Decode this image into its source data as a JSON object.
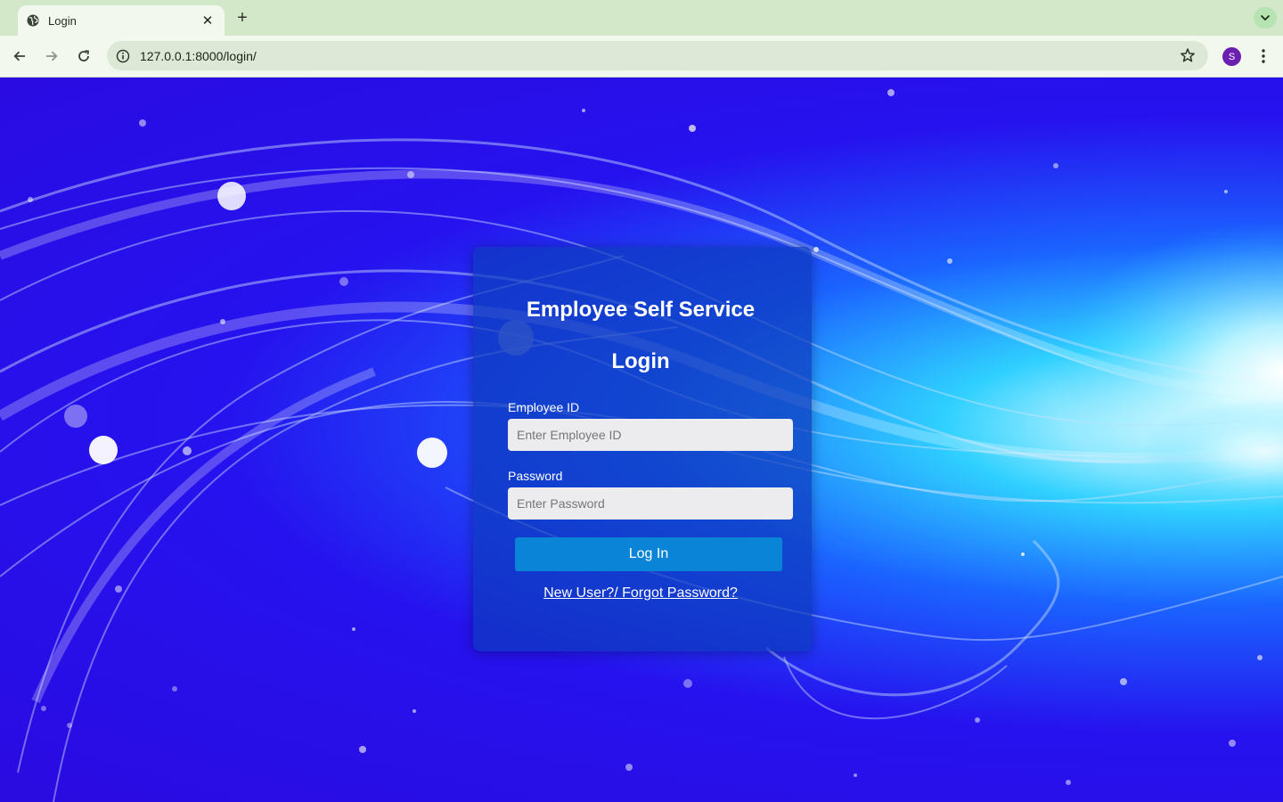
{
  "browser": {
    "tab_title": "Login",
    "new_tab_symbol": "+",
    "close_symbol": "✕",
    "url": "127.0.0.1:8000/login/",
    "profile_initial": "S",
    "colors": {
      "tabstrip": "#d3e8c9",
      "toolbar": "#f2f8ee",
      "profile": "#6b1fb0"
    },
    "icons": [
      "globe-icon",
      "close-icon",
      "plus-icon",
      "chevron-down-icon",
      "back-arrow-icon",
      "forward-arrow-icon",
      "reload-icon",
      "info-icon",
      "star-icon",
      "kebab-menu-icon"
    ]
  },
  "login": {
    "title": "Employee Self Service",
    "subtitle": "Login",
    "employee_id": {
      "label": "Employee ID",
      "placeholder": "Enter Employee ID",
      "value": ""
    },
    "password": {
      "label": "Password",
      "placeholder": "Enter Password",
      "value": ""
    },
    "submit_label": "Log In",
    "help_link": "New User?/ Forgot Password?",
    "colors": {
      "card": "#0e3abe",
      "button": "#0a84d6",
      "input": "#ececef"
    }
  }
}
